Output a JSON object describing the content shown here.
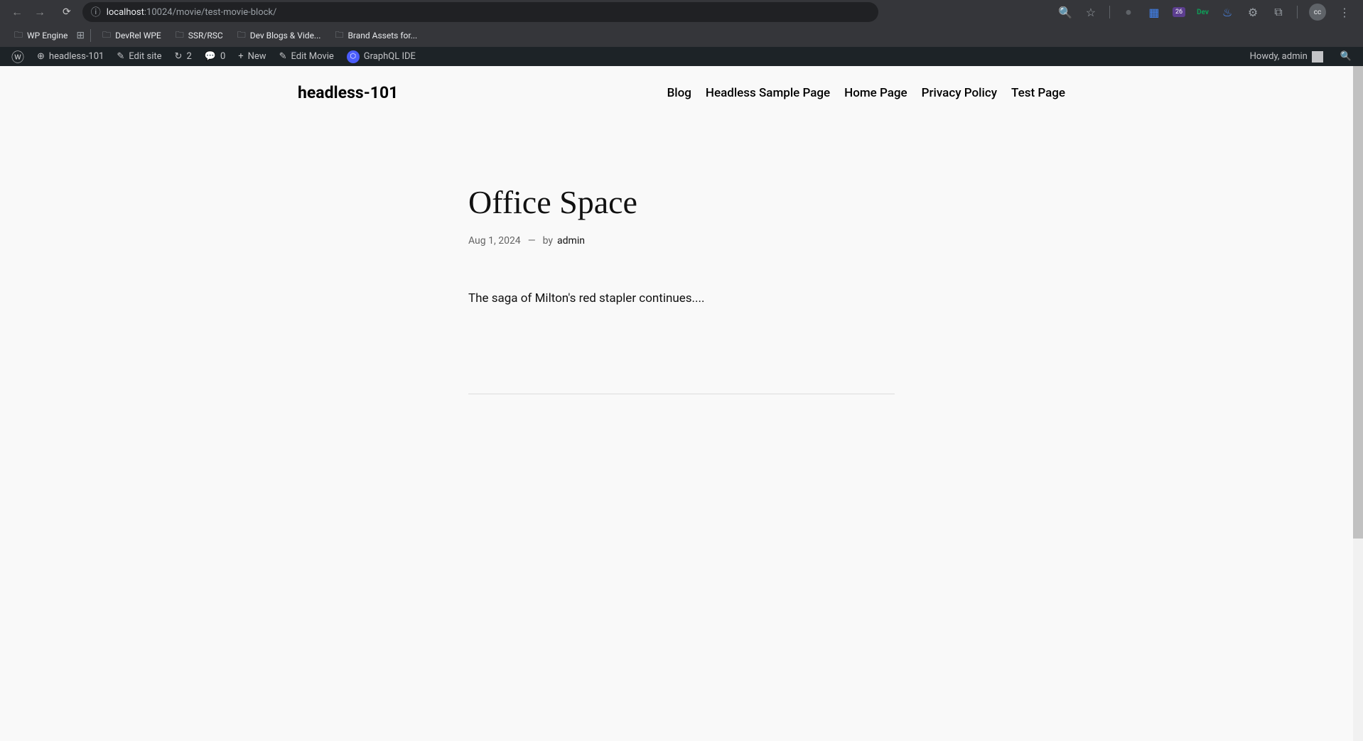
{
  "browser": {
    "url_host": "localhost",
    "url_path": ":10024/movie/test-movie-block/",
    "ext_badge": "26",
    "avatar_initials": "cc"
  },
  "bookmarks": [
    {
      "label": "WP Engine",
      "type": "site"
    },
    {
      "type": "grid"
    },
    {
      "type": "divider"
    },
    {
      "label": "DevRel WPE",
      "type": "folder"
    },
    {
      "label": "SSR/RSC",
      "type": "folder"
    },
    {
      "label": "Dev Blogs & Vide...",
      "type": "folder"
    },
    {
      "label": "Brand Assets for...",
      "type": "folder"
    }
  ],
  "wp_admin": {
    "site_name": "headless-101",
    "edit_site": "Edit site",
    "updates_count": "2",
    "comments_count": "0",
    "new_label": "New",
    "edit_movie": "Edit Movie",
    "graphql": "GraphQL IDE",
    "howdy": "Howdy, admin"
  },
  "site": {
    "title": "headless-101",
    "nav": [
      "Blog",
      "Headless Sample Page",
      "Home Page",
      "Privacy Policy",
      "Test Page"
    ]
  },
  "post": {
    "title": "Office Space",
    "date": "Aug 1, 2024",
    "separator": "—",
    "by_label": "by",
    "author": "admin",
    "excerpt": "The saga of Milton's red stapler continues...."
  }
}
